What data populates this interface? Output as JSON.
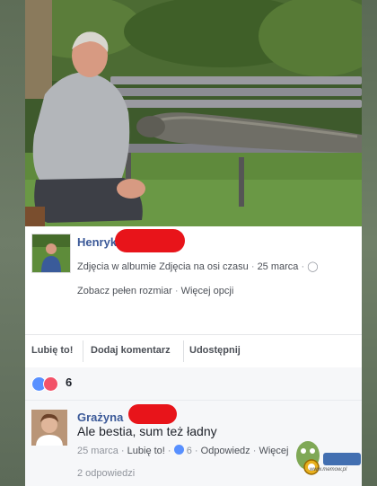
{
  "post": {
    "author": "Henryk",
    "meta_album": "Zdjęcia w albumie Zdjęcia na osi czasu",
    "meta_date": "25 marca",
    "link_full": "Zobacz pełen rozmiar",
    "link_more": "Więcej opcji"
  },
  "actions": {
    "like": "Lubię to!",
    "comment": "Dodaj komentarz",
    "share": "Udostępnij"
  },
  "reactions": {
    "count": "6",
    "icons": [
      "like-icon",
      "love-icon"
    ]
  },
  "comment": {
    "author": "Grażyna",
    "text": "Ale bestia, sum też ładny",
    "date": "25 marca",
    "like": "Lubię to!",
    "likes_count": "6",
    "reply": "Odpowiedz",
    "more": "Więcej",
    "replies": "2 odpowiedzi"
  },
  "watermark": {
    "site": "www.memow.pl"
  },
  "colors": {
    "link": "#3b5998",
    "redaction": "#e8141a",
    "like_blue": "#5890ff",
    "love_red": "#f25268"
  }
}
